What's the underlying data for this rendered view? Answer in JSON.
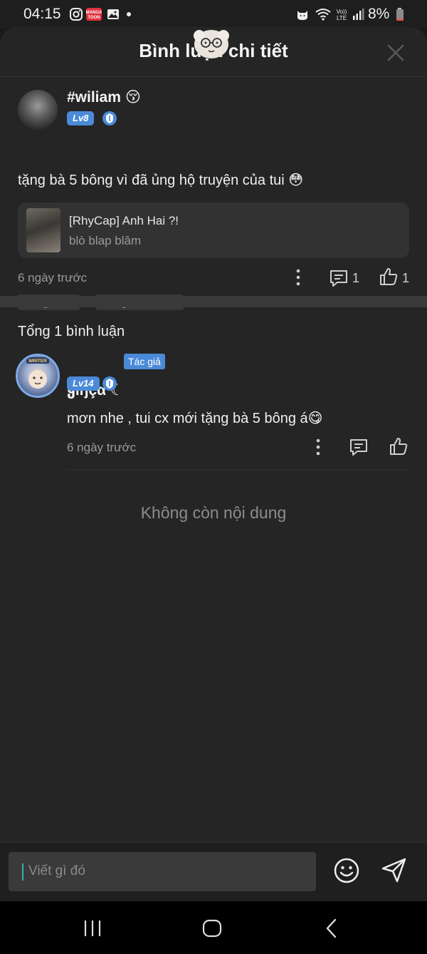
{
  "status_bar": {
    "time": "04:15",
    "battery": "8%",
    "left_icons": [
      "instagram-icon",
      "mangatoon-icon",
      "gallery-icon",
      "dot-icon"
    ],
    "right_icons": [
      "cat-icon",
      "wifi-icon",
      "volte-icon",
      "signal-icon",
      "battery-icon"
    ],
    "mangatoon_label": "MANGA TOON"
  },
  "header": {
    "title": "Bình luận chi tiết",
    "close_icon": "close-icon"
  },
  "post": {
    "username": "#wiliam",
    "username_emoji": "😚",
    "level": "Lv8",
    "text": "tặng bà 5 bông vì đã ủng hộ truyện của tui 😳",
    "story": {
      "title": "[RhyCap] Anh Hai ?!",
      "author": "blò blap blâm"
    },
    "time": "6 ngày trước",
    "comment_count": "1",
    "like_count": "1",
    "tags": [
      "Tác giả like",
      "Tác giả bình luận"
    ]
  },
  "comments_section": {
    "total_label": "Tổng 1 bình luận",
    "comments": [
      {
        "username": "ყıŋçα ☾",
        "author_tag": "Tác giả",
        "level": "Lv14",
        "text": "mơn nhe , tui cx mới tặng bà 5 bông á😋",
        "time": "6 ngày trước",
        "avatar_badge": "WRITER"
      }
    ],
    "empty_label": "Không còn nội dung"
  },
  "composer": {
    "placeholder": "Viết gì đó",
    "emoji_icon": "emoji-icon",
    "send_icon": "send-icon"
  },
  "nav": {
    "buttons": [
      "recents-icon",
      "home-icon",
      "back-icon"
    ]
  },
  "colors": {
    "background": "#252525",
    "accent": "#4a8ad8",
    "muted_text": "#9a9a9a"
  }
}
